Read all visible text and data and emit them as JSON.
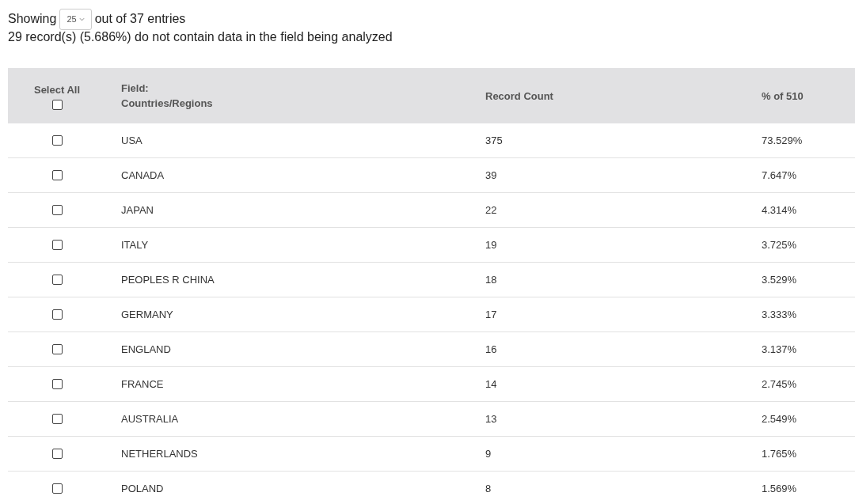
{
  "summary": {
    "showing_label": "Showing",
    "page_size": "25",
    "entries_label": "out of 37 entries",
    "missing_note": "29 record(s) (5.686%) do not contain data in the field being analyzed"
  },
  "table": {
    "select_all": {
      "label": "Select All",
      "checked": false
    },
    "columns": [
      "Field:\nCountries/Regions",
      "Record Count",
      "% of 510"
    ],
    "rows": [
      {
        "checked": false,
        "cells": [
          "USA",
          "375",
          "73.529%"
        ]
      },
      {
        "checked": false,
        "cells": [
          "CANADA",
          "39",
          "7.647%"
        ]
      },
      {
        "checked": false,
        "cells": [
          "JAPAN",
          "22",
          "4.314%"
        ]
      },
      {
        "checked": false,
        "cells": [
          "ITALY",
          "19",
          "3.725%"
        ]
      },
      {
        "checked": false,
        "cells": [
          "PEOPLES R CHINA",
          "18",
          "3.529%"
        ]
      },
      {
        "checked": false,
        "cells": [
          "GERMANY",
          "17",
          "3.333%"
        ]
      },
      {
        "checked": false,
        "cells": [
          "ENGLAND",
          "16",
          "3.137%"
        ]
      },
      {
        "checked": false,
        "cells": [
          "FRANCE",
          "14",
          "2.745%"
        ]
      },
      {
        "checked": false,
        "cells": [
          "AUSTRALIA",
          "13",
          "2.549%"
        ]
      },
      {
        "checked": false,
        "cells": [
          "NETHERLANDS",
          "9",
          "1.765%"
        ]
      },
      {
        "checked": false,
        "cells": [
          "POLAND",
          "8",
          "1.569%"
        ]
      }
    ]
  }
}
